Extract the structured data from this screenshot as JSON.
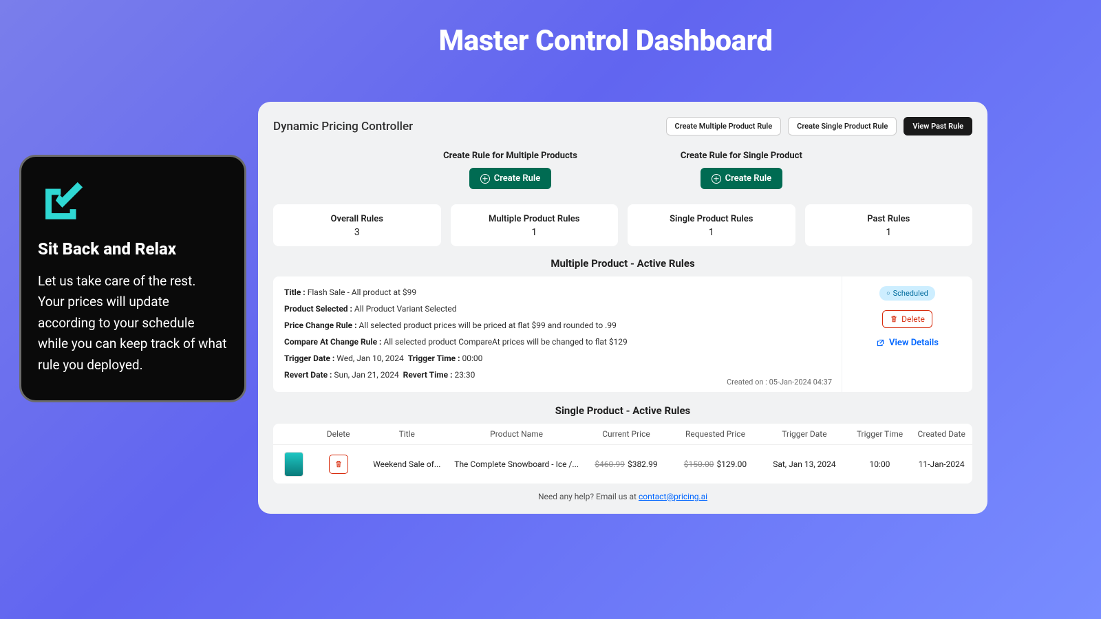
{
  "hero": {
    "title": "Master Control Dashboard"
  },
  "promo": {
    "title": "Sit Back and Relax",
    "body": "Let us take care of the rest.\nYour prices will update according to your schedule while you can keep track of what rule you deployed."
  },
  "app": {
    "title": "Dynamic Pricing Controller",
    "header_buttons": {
      "multi": "Create Multiple Product Rule",
      "single": "Create Single Product Rule",
      "past": "View Past Rule"
    },
    "create": {
      "multi_label": "Create Rule for Multiple Products",
      "single_label": "Create Rule for Single Product",
      "button": "Create Rule"
    },
    "stats": [
      {
        "label": "Overall Rules",
        "value": "3"
      },
      {
        "label": "Multiple Product Rules",
        "value": "1"
      },
      {
        "label": "Single Product Rules",
        "value": "1"
      },
      {
        "label": "Past Rules",
        "value": "1"
      }
    ],
    "multi_section_title": "Multiple Product - Active Rules",
    "single_section_title": "Single Product - Active Rules",
    "rule": {
      "title_label": "Title :",
      "title": "Flash Sale - All product at $99",
      "ps_label": "Product Selected :",
      "ps": "All Product Variant Selected",
      "pcr_label": "Price Change Rule :",
      "pcr": "All selected product prices will be priced at flat $99 and rounded to .99",
      "ccr_label": "Compare At Change Rule :",
      "ccr": "All selected product CompareAt prices will be changed to flat $129",
      "td_label": "Trigger Date :",
      "td": "Wed, Jan 10, 2024",
      "tt_label": "Trigger Time :",
      "tt": "00:00",
      "rd_label": "Revert Date :",
      "rd": "Sun, Jan 21, 2024",
      "rt_label": "Revert Time :",
      "rt": "23:30",
      "created": "Created on : 05-Jan-2024 04:37",
      "badge": "Scheduled",
      "delete": "Delete",
      "view": "View Details"
    },
    "table": {
      "headers": {
        "delete": "Delete",
        "title": "Title",
        "pname": "Product Name",
        "cprice": "Current Price",
        "rprice": "Requested Price",
        "tdate": "Trigger Date",
        "ttime": "Trigger Time",
        "cdate": "Created Date"
      },
      "row": {
        "title": "Weekend Sale of...",
        "pname": "The Complete Snowboard - Ice /...",
        "cprice_old": "$460.99",
        "cprice_new": "$382.99",
        "rprice_old": "$150.00",
        "rprice_new": "$129.00",
        "tdate": "Sat, Jan 13, 2024",
        "ttime": "10:00",
        "cdate": "11-Jan-2024"
      }
    },
    "help": {
      "text": "Need any help? Email us at ",
      "email": "contact@pricing.ai"
    }
  }
}
